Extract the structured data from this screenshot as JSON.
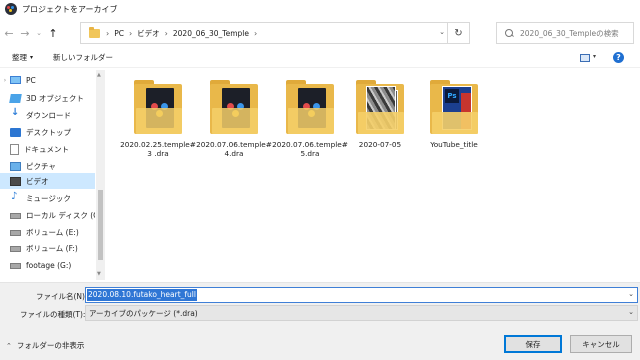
{
  "window": {
    "title": "プロジェクトをアーカイブ"
  },
  "nav": {
    "back": "←",
    "forward": "→",
    "recent_dropdown": "⌄",
    "up": "↑",
    "breadcrumbs": [
      "PC",
      "ビデオ",
      "2020_06_30_Temple"
    ],
    "separator": "›",
    "address_dropdown": "⌄",
    "refresh": "↻",
    "search_placeholder": "2020_06_30_Templeの検索"
  },
  "toolbar": {
    "organize": "整理",
    "organize_caret": "▾",
    "new_folder": "新しいフォルダー",
    "view_caret": "▾",
    "help": "?"
  },
  "sidebar": {
    "items": [
      {
        "label": "PC",
        "icon": "pc-icon"
      },
      {
        "label": "3D オブジェクト",
        "icon": "3d-objects-icon"
      },
      {
        "label": "ダウンロード",
        "icon": "download-icon"
      },
      {
        "label": "デスクトップ",
        "icon": "desktop-icon"
      },
      {
        "label": "ドキュメント",
        "icon": "document-icon"
      },
      {
        "label": "ピクチャ",
        "icon": "pictures-icon"
      },
      {
        "label": "ビデオ",
        "icon": "videos-icon"
      },
      {
        "label": "ミュージック",
        "icon": "music-icon"
      },
      {
        "label": "ローカル ディスク (C",
        "icon": "drive-icon"
      },
      {
        "label": "ボリューム (E:)",
        "icon": "drive-icon"
      },
      {
        "label": "ボリューム (F:)",
        "icon": "drive-icon"
      },
      {
        "label": "footage (G:)",
        "icon": "drive-icon"
      }
    ],
    "selected_index": 6,
    "scroll_up": "▲",
    "scroll_down": "▼"
  },
  "files": [
    {
      "label": "2020.02.25.temple# 3 .dra",
      "icon": "resolve-archive-folder-icon"
    },
    {
      "label": "2020.07.06.temple#4.dra",
      "icon": "resolve-archive-folder-icon"
    },
    {
      "label": "2020.07.06.temple#5.dra",
      "icon": "resolve-archive-folder-icon"
    },
    {
      "label": "2020-07-05",
      "icon": "photo-folder-icon"
    },
    {
      "label": "YouTube_title",
      "icon": "photoshop-folder-icon",
      "thumb_text": "Ps"
    }
  ],
  "form": {
    "filename_label": "ファイル名(N):",
    "filename_value": "2020.08.10.futako_heart_full",
    "filetype_label": "ファイルの種類(T):",
    "filetype_value": "アーカイブのパッケージ (*.dra)",
    "dropdown": "⌄"
  },
  "footer": {
    "hide_folders": "フォルダーの非表示",
    "hide_chevron": "⌃",
    "save": "保存",
    "cancel": "キャンセル"
  },
  "colors": {
    "selection": "#cde8ff",
    "accent": "#0078d7",
    "text_selection": "#2f76d5",
    "folder": "#f5cf68"
  }
}
